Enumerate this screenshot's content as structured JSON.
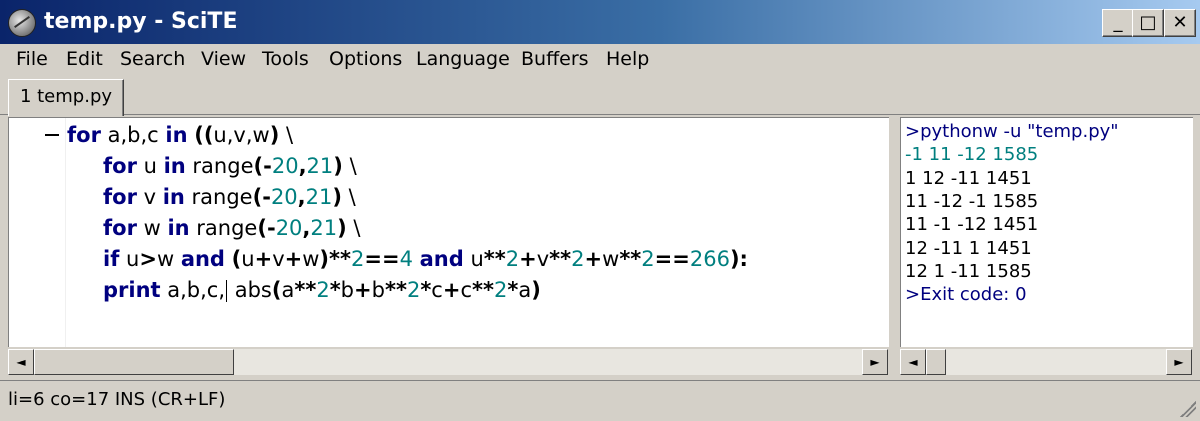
{
  "window": {
    "title": "temp.py - SciTE"
  },
  "titlebar": {
    "minimize": "_",
    "maximize": "□",
    "close": "✕"
  },
  "menu": [
    "File",
    "Edit",
    "Search",
    "View",
    "Tools",
    "Options",
    "Language",
    "Buffers",
    "Help"
  ],
  "tabs": [
    {
      "label": "1 temp.py"
    }
  ],
  "editor": {
    "lines": [
      [
        {
          "t": "for",
          "k": "kw"
        },
        {
          "t": " a,b,c "
        },
        {
          "t": "in",
          "k": "kw"
        },
        {
          "t": " "
        },
        {
          "t": "((",
          "k": "op"
        },
        {
          "t": "u,v,w"
        },
        {
          "t": ")",
          "k": "op"
        },
        {
          "t": " \\"
        }
      ],
      [
        {
          "t": "for",
          "k": "kw"
        },
        {
          "t": " u "
        },
        {
          "t": "in",
          "k": "kw"
        },
        {
          "t": " range"
        },
        {
          "t": "(-",
          "k": "op"
        },
        {
          "t": "20",
          "k": "num"
        },
        {
          "t": ",",
          "k": "op"
        },
        {
          "t": "21",
          "k": "num"
        },
        {
          "t": ")",
          "k": "op"
        },
        {
          "t": " \\"
        }
      ],
      [
        {
          "t": "for",
          "k": "kw"
        },
        {
          "t": " v "
        },
        {
          "t": "in",
          "k": "kw"
        },
        {
          "t": " range"
        },
        {
          "t": "(-",
          "k": "op"
        },
        {
          "t": "20",
          "k": "num"
        },
        {
          "t": ",",
          "k": "op"
        },
        {
          "t": "21",
          "k": "num"
        },
        {
          "t": ")",
          "k": "op"
        },
        {
          "t": " \\"
        }
      ],
      [
        {
          "t": "for",
          "k": "kw"
        },
        {
          "t": " w "
        },
        {
          "t": "in",
          "k": "kw"
        },
        {
          "t": " range"
        },
        {
          "t": "(-",
          "k": "op"
        },
        {
          "t": "20",
          "k": "num"
        },
        {
          "t": ",",
          "k": "op"
        },
        {
          "t": "21",
          "k": "num"
        },
        {
          "t": ")",
          "k": "op"
        },
        {
          "t": " \\"
        }
      ],
      [
        {
          "t": "if",
          "k": "kw"
        },
        {
          "t": " u"
        },
        {
          "t": ">",
          "k": "op"
        },
        {
          "t": "w "
        },
        {
          "t": "and",
          "k": "kw"
        },
        {
          "t": " "
        },
        {
          "t": "(",
          "k": "op"
        },
        {
          "t": "u"
        },
        {
          "t": "+",
          "k": "op"
        },
        {
          "t": "v"
        },
        {
          "t": "+",
          "k": "op"
        },
        {
          "t": "w"
        },
        {
          "t": ")**",
          "k": "op"
        },
        {
          "t": "2",
          "k": "num"
        },
        {
          "t": "==",
          "k": "op"
        },
        {
          "t": "4",
          "k": "num"
        },
        {
          "t": " "
        },
        {
          "t": "and",
          "k": "kw"
        },
        {
          "t": " u"
        },
        {
          "t": "**",
          "k": "op"
        },
        {
          "t": "2",
          "k": "num"
        },
        {
          "t": "+",
          "k": "op"
        },
        {
          "t": "v"
        },
        {
          "t": "**",
          "k": "op"
        },
        {
          "t": "2",
          "k": "num"
        },
        {
          "t": "+",
          "k": "op"
        },
        {
          "t": "w"
        },
        {
          "t": "**",
          "k": "op"
        },
        {
          "t": "2",
          "k": "num"
        },
        {
          "t": "==",
          "k": "op"
        },
        {
          "t": "266",
          "k": "num"
        },
        {
          "t": "):",
          "k": "op"
        }
      ],
      [
        {
          "t": "print",
          "k": "kw"
        },
        {
          "t": " a,b,c,"
        },
        {
          "t": "",
          "k": "caret"
        },
        {
          "t": " abs"
        },
        {
          "t": "(",
          "k": "op"
        },
        {
          "t": "a"
        },
        {
          "t": "**",
          "k": "op"
        },
        {
          "t": "2",
          "k": "num"
        },
        {
          "t": "*",
          "k": "op"
        },
        {
          "t": "b"
        },
        {
          "t": "+",
          "k": "op"
        },
        {
          "t": "b"
        },
        {
          "t": "**",
          "k": "op"
        },
        {
          "t": "2",
          "k": "num"
        },
        {
          "t": "*",
          "k": "op"
        },
        {
          "t": "c"
        },
        {
          "t": "+",
          "k": "op"
        },
        {
          "t": "c"
        },
        {
          "t": "**",
          "k": "op"
        },
        {
          "t": "2",
          "k": "num"
        },
        {
          "t": "*",
          "k": "op"
        },
        {
          "t": "a"
        },
        {
          "t": ")",
          "k": "op"
        }
      ]
    ]
  },
  "output": {
    "lines": [
      {
        "text": ">pythonw -u \"temp.py\"",
        "style": "cmd"
      },
      {
        "text": "-1 11 -12 1585",
        "style": "first"
      },
      {
        "text": "1 12 -11 1451",
        "style": "plain"
      },
      {
        "text": "11 -12 -1 1585",
        "style": "plain"
      },
      {
        "text": "11 -1 -12 1451",
        "style": "plain"
      },
      {
        "text": "12 -11 1 1451",
        "style": "plain"
      },
      {
        "text": "12 1 -11 1585",
        "style": "plain"
      },
      {
        "text": ">Exit code: 0",
        "style": "cmd"
      }
    ]
  },
  "scroll": {
    "left_arrow": "◄",
    "right_arrow": "►"
  },
  "statusbar": {
    "text": "li=6 co=17 INS (CR+LF)"
  },
  "colors": {
    "keyword": "#00007f",
    "number": "#007f7f",
    "titlebar_start": "#0a246a",
    "titlebar_end": "#a6caf0"
  }
}
